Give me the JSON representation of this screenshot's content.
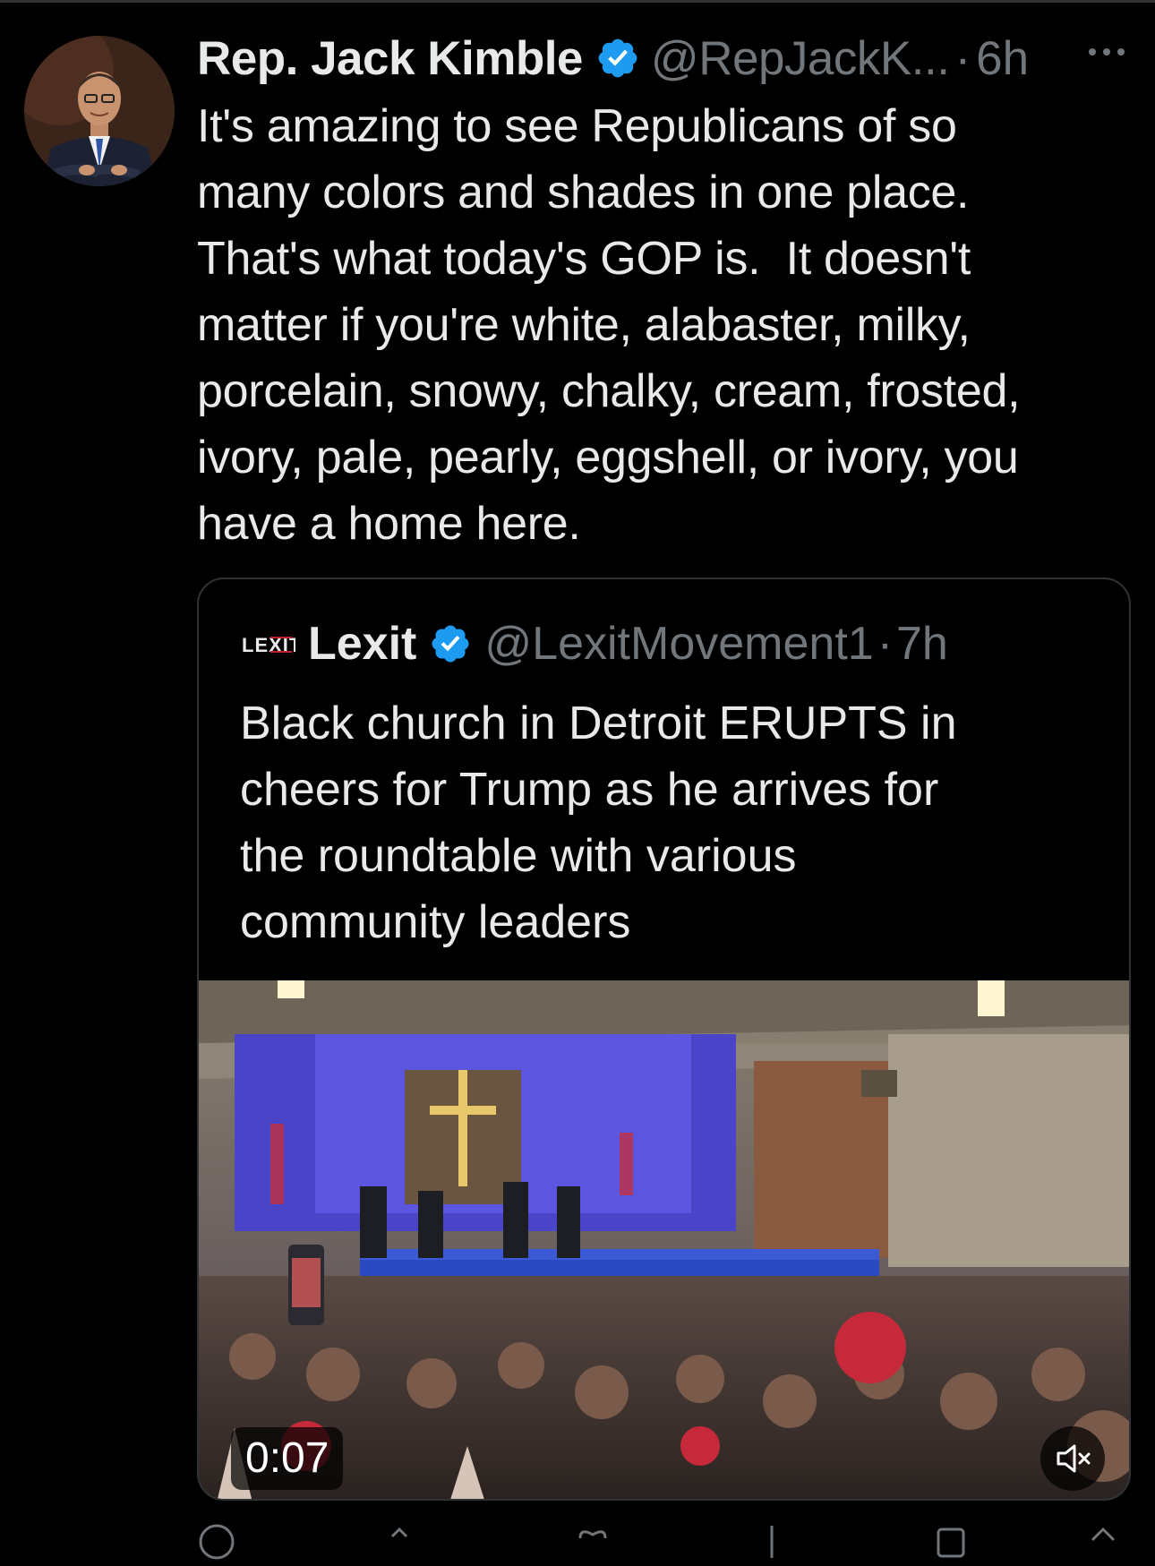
{
  "author": {
    "display_name": "Rep. Jack Kimble",
    "handle": "@RepJackK...",
    "separator": "·",
    "time": "6h",
    "verified_icon": "verified-badge-icon",
    "verified_color": "#1d9bf0"
  },
  "tweet": {
    "text": "It's amazing to see Republicans of so\nmany colors and shades in one place.\nThat's what today's GOP is.  It doesn't\nmatter if you're white, alabaster, milky,\nporcelain, snowy, chalky, cream, frosted,\nivory, pale, pearly, eggshell, or ivory, you\nhave a home here."
  },
  "quoted": {
    "logo_text": "LEXIT",
    "display_name": "Lexit",
    "handle": "@LexitMovement1",
    "separator": "·",
    "time": "7h",
    "text": "Black church in Detroit ERUPTS in\ncheers for Trump as he arrives for\nthe roundtable with various\ncommunity leaders",
    "video": {
      "timestamp": "0:07",
      "muted": true
    }
  },
  "colors": {
    "background": "#000000",
    "text_primary": "#e7e9ea",
    "text_secondary": "#71767b",
    "border": "#2f3336",
    "accent": "#1d9bf0"
  },
  "action_icons": [
    "reply-icon",
    "repost-icon",
    "like-icon",
    "views-icon",
    "bookmark-icon",
    "share-icon"
  ]
}
